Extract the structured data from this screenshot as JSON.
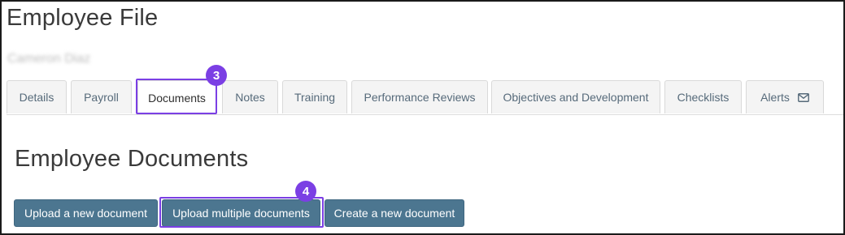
{
  "page": {
    "title": "Employee File",
    "employee_name": "Cameron Diaz"
  },
  "tabs": [
    {
      "label": "Details"
    },
    {
      "label": "Payroll"
    },
    {
      "label": "Documents",
      "active": true
    },
    {
      "label": "Notes"
    },
    {
      "label": "Training"
    },
    {
      "label": "Performance Reviews"
    },
    {
      "label": "Objectives and Development"
    },
    {
      "label": "Checklists"
    },
    {
      "label": "Alerts",
      "icon": "envelope-icon"
    }
  ],
  "section": {
    "title": "Employee Documents"
  },
  "buttons": {
    "upload_new": "Upload a new document",
    "upload_multiple": "Upload multiple documents",
    "create_new": "Create a new document"
  },
  "annotations": {
    "step_3": "3",
    "step_4": "4"
  },
  "colors": {
    "highlight": "#7b3fe4",
    "button": "#4c7690",
    "tab_text": "#566a7a"
  }
}
